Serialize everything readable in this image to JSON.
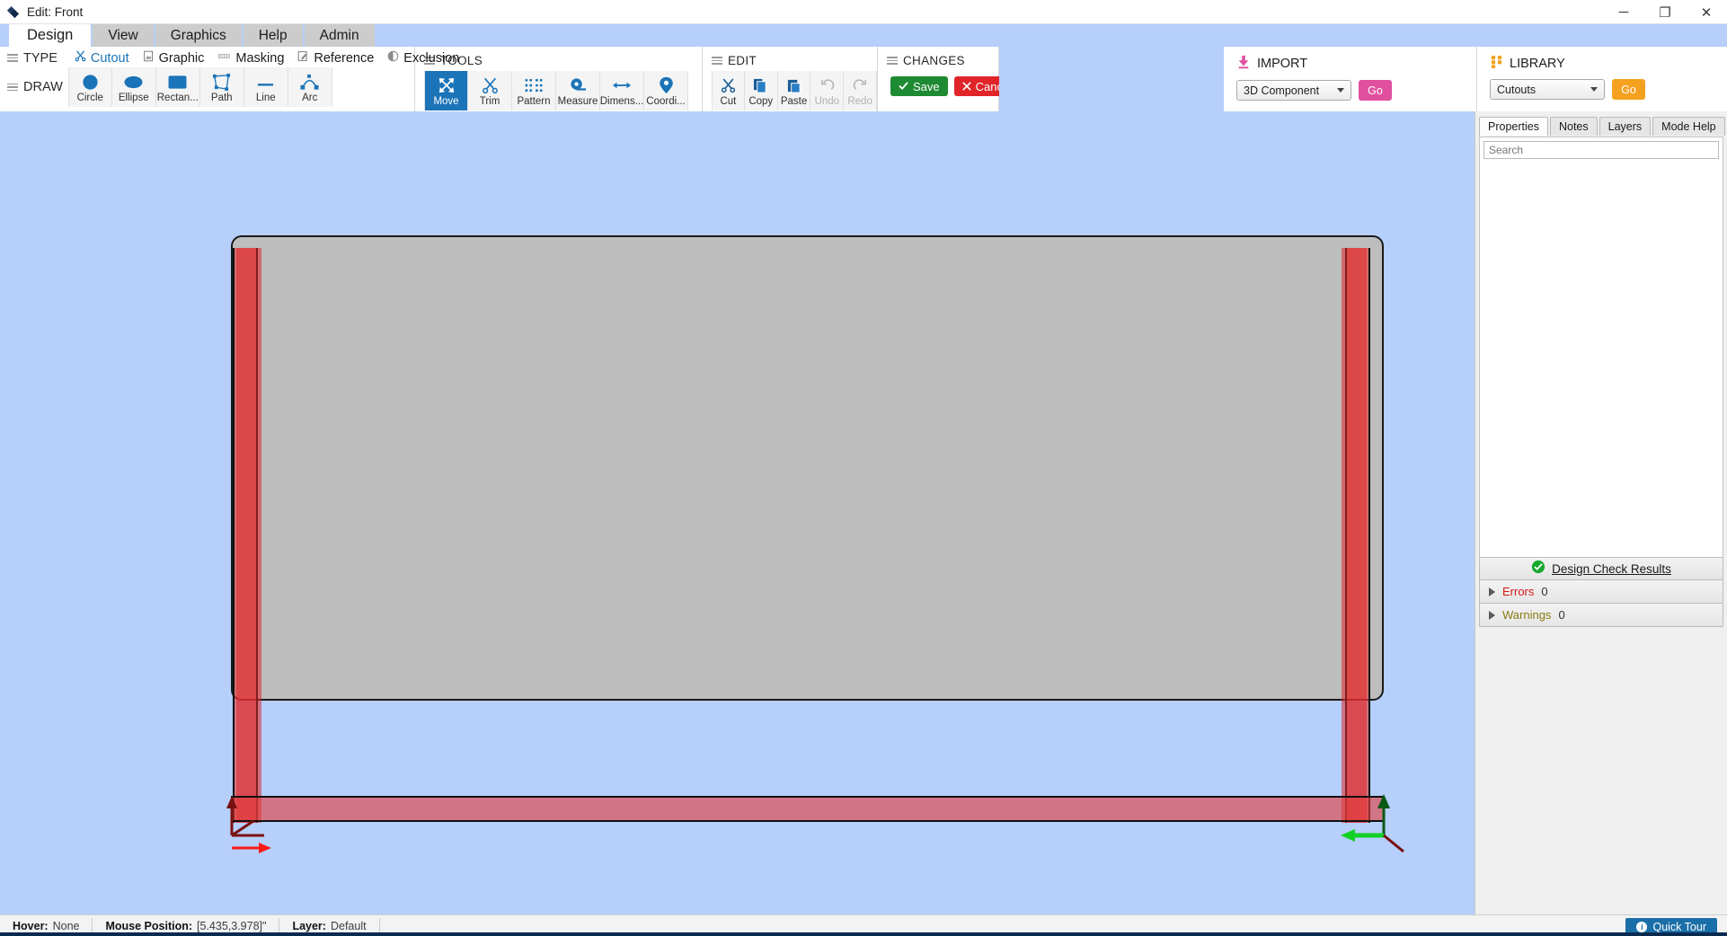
{
  "window": {
    "title": "Edit: Front",
    "logo_icon": "app-logo-icon",
    "minimize": "─",
    "maximize": "❐",
    "close": "✕"
  },
  "tabs": [
    {
      "label": "Design",
      "active": true
    },
    {
      "label": "View",
      "active": false
    },
    {
      "label": "Graphics",
      "active": false
    },
    {
      "label": "Help",
      "active": false
    },
    {
      "label": "Admin",
      "active": false
    }
  ],
  "ribbon": {
    "type": {
      "label": "TYPE",
      "items": [
        {
          "label": "Cutout",
          "icon": "scissors-icon",
          "selected": true
        },
        {
          "label": "Graphic",
          "icon": "image-icon",
          "selected": false
        },
        {
          "label": "Masking",
          "icon": "masking-icon",
          "selected": false
        },
        {
          "label": "Reference",
          "icon": "reference-pencil-icon",
          "selected": false
        },
        {
          "label": "Exclusion",
          "icon": "half-circle-icon",
          "selected": false
        }
      ]
    },
    "draw": {
      "label": "DRAW",
      "items": [
        {
          "label": "Circle",
          "icon": "circle-icon"
        },
        {
          "label": "Ellipse",
          "icon": "ellipse-icon"
        },
        {
          "label": "Rectan...",
          "icon": "rectangle-icon"
        },
        {
          "label": "Path",
          "icon": "path-icon"
        },
        {
          "label": "Line",
          "icon": "line-icon"
        },
        {
          "label": "Arc",
          "icon": "arc-icon"
        }
      ]
    },
    "tools": {
      "label": "TOOLS",
      "items": [
        {
          "label": "Move",
          "icon": "move-arrows-icon",
          "active": true
        },
        {
          "label": "Trim",
          "icon": "scissors-icon",
          "active": false
        },
        {
          "label": "Pattern",
          "icon": "pattern-dots-icon",
          "active": false
        },
        {
          "label": "Measure",
          "icon": "measure-tape-icon",
          "active": false
        },
        {
          "label": "Dimens...",
          "icon": "dimension-arrow-icon",
          "active": false
        },
        {
          "label": "Coordi...",
          "icon": "map-pin-icon",
          "active": false
        }
      ]
    },
    "edit": {
      "label": "EDIT",
      "items": [
        {
          "label": "Cut",
          "icon": "scissors-icon",
          "disabled": false
        },
        {
          "label": "Copy",
          "icon": "copy-icon",
          "disabled": false
        },
        {
          "label": "Paste",
          "icon": "paste-icon",
          "disabled": false
        },
        {
          "label": "Undo",
          "icon": "undo-arrow-icon",
          "disabled": true
        },
        {
          "label": "Redo",
          "icon": "redo-arrow-icon",
          "disabled": true
        }
      ]
    },
    "changes": {
      "label": "CHANGES",
      "save_label": "Save",
      "save_icon": "check-icon",
      "save_color": "#1e8a33",
      "cancel_label": "Cancel",
      "cancel_icon": "x-icon",
      "cancel_color": "#e0252a"
    },
    "import": {
      "label": "IMPORT",
      "icon": "download-icon",
      "accent": "#e0509e",
      "select_value": "3D Component",
      "go_label": "Go"
    },
    "library": {
      "label": "LIBRARY",
      "icon": "grid-dots-icon",
      "accent": "#f5a120",
      "select_value": "Cutouts",
      "go_label": "Go"
    }
  },
  "dock": {
    "tabs": [
      {
        "label": "Properties",
        "active": true
      },
      {
        "label": "Notes",
        "active": false
      },
      {
        "label": "Layers",
        "active": false
      },
      {
        "label": "Mode Help",
        "active": false
      }
    ],
    "search_placeholder": "Search",
    "search_value": "",
    "design_check": {
      "label": "Design Check Results",
      "icon": "check-circle-green-icon",
      "rows": [
        {
          "label": "Errors",
          "count": "0",
          "kind": "error"
        },
        {
          "label": "Warnings",
          "count": "0",
          "kind": "warning"
        }
      ]
    }
  },
  "canvas": {
    "board_fill": "#bdbdbd",
    "overlay_fill": "#e23c3c",
    "background": "#b6cffb",
    "origin_marker": "origin-axis-marker",
    "corner_marker": "corner-axis-marker"
  },
  "statusbar": {
    "hover_key": "Hover:",
    "hover_value": "None",
    "mouse_key": "Mouse Position:",
    "mouse_value": "[5.435,3.978]\"",
    "layer_key": "Layer:",
    "layer_value": "Default",
    "quick_tour": "Quick Tour",
    "quick_tour_icon": "info-icon"
  }
}
